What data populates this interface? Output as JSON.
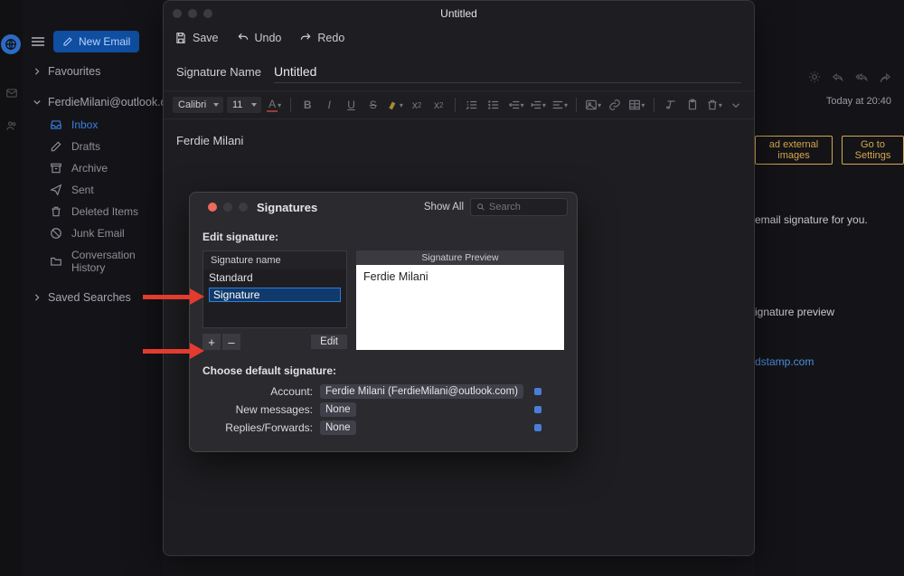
{
  "sidebar": {
    "new_email": "New Email",
    "favourites": "Favourites",
    "account": "FerdieMilani@outlook.co",
    "folders": {
      "inbox": "Inbox",
      "drafts": "Drafts",
      "archive": "Archive",
      "sent": "Sent",
      "deleted": "Deleted Items",
      "junk": "Junk Email",
      "history": "Conversation History"
    },
    "saved_searches": "Saved Searches"
  },
  "editor": {
    "window_title": "Untitled",
    "toolbar": {
      "save": "Save",
      "undo": "Undo",
      "redo": "Redo"
    },
    "signature_name_label": "Signature Name",
    "signature_name_value": "Untitled",
    "font": "Calibri",
    "font_size": "11",
    "body_text": "Ferdie Milani"
  },
  "background": {
    "timestamp": "Today at 20:40",
    "btn_download": "ad external images",
    "btn_settings": "Go to Settings",
    "line_sig": "email signature for you.",
    "line_preview": "ignature preview",
    "link_frag": "dstamp.com"
  },
  "signatures": {
    "title": "Signatures",
    "show_all": "Show All",
    "search_placeholder": "Search",
    "edit_label": "Edit signature:",
    "list_header": "Signature name",
    "items": {
      "standard": "Standard",
      "editing": "Signature"
    },
    "btn_plus": "+",
    "btn_minus": "–",
    "btn_edit": "Edit",
    "preview_header": "Signature Preview",
    "preview_body": "Ferdie Milani",
    "defaults_label": "Choose default signature:",
    "form": {
      "account_label": "Account:",
      "account_value": "Ferdie Milani (FerdieMilani@outlook.com)",
      "newmsg_label": "New messages:",
      "newmsg_value": "None",
      "replies_label": "Replies/Forwards:",
      "replies_value": "None"
    }
  }
}
